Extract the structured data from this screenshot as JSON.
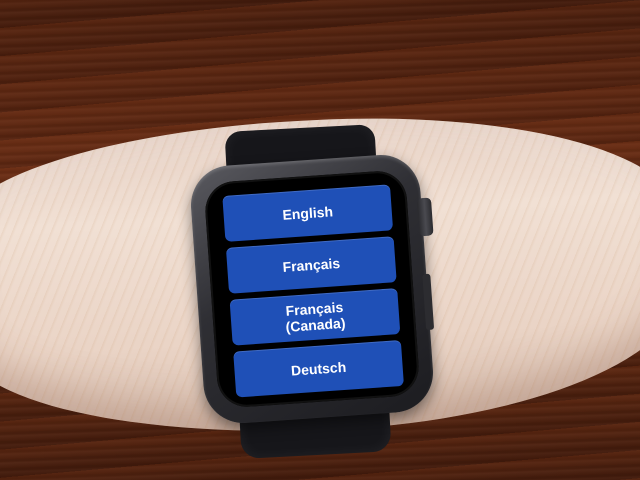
{
  "language_picker": {
    "items": [
      {
        "label": "English"
      },
      {
        "label": "Français"
      },
      {
        "label": "Français\n(Canada)"
      },
      {
        "label": "Deutsch"
      }
    ]
  },
  "colors": {
    "button_bg": "#1f50b7",
    "button_text": "#ffffff",
    "screen_bg": "#000000"
  },
  "icons": {
    "digital_crown": "digital-crown",
    "side_button": "side-button"
  }
}
